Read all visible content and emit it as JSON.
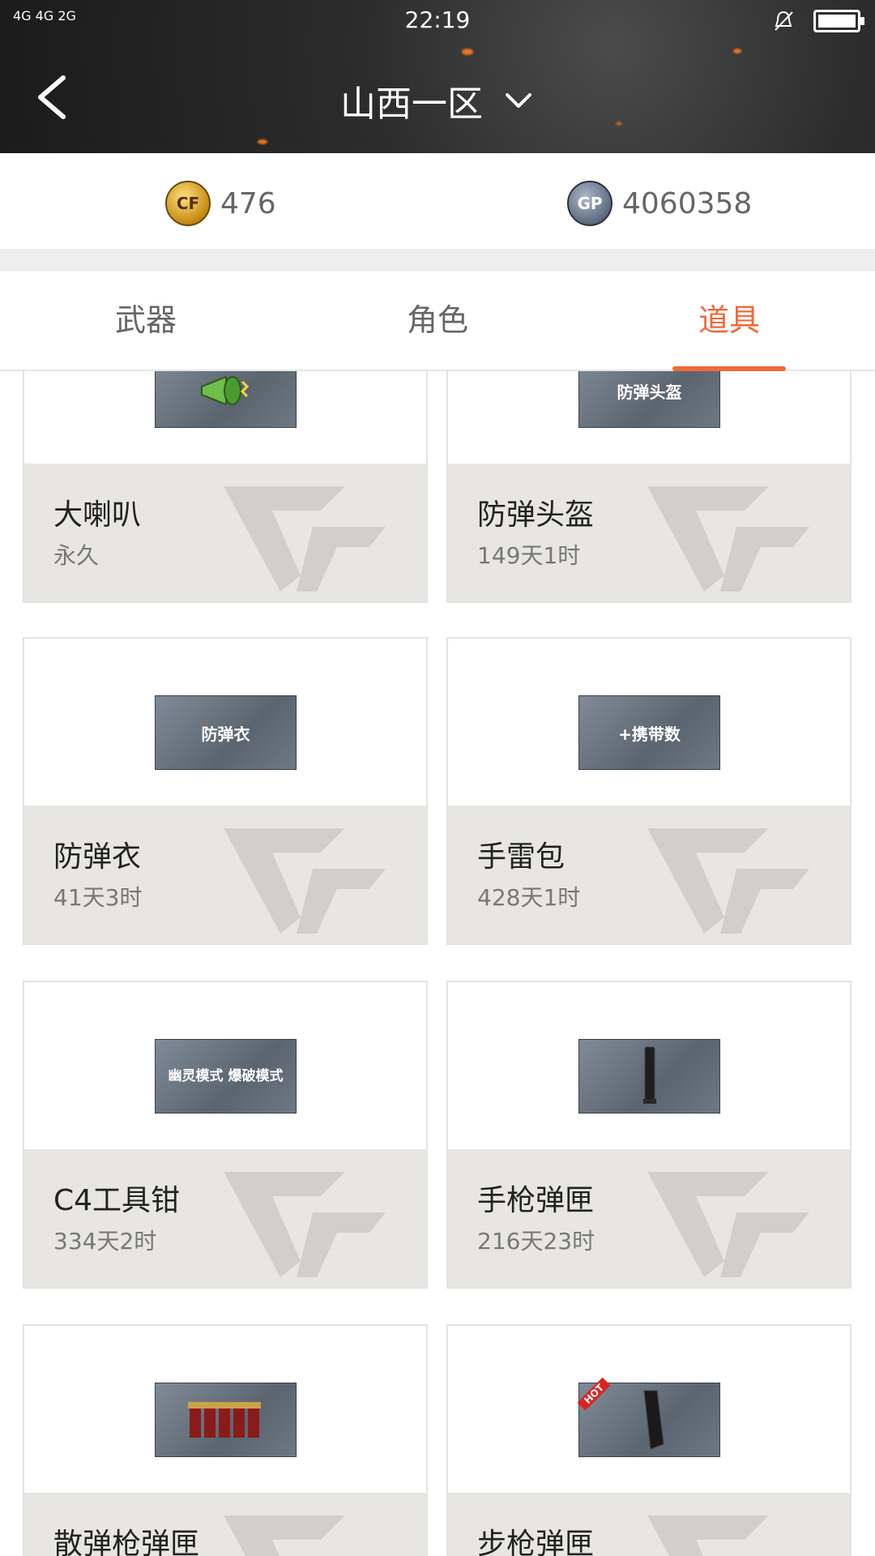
{
  "status_bar": {
    "network": "4G 4G 2G",
    "time": "22:19"
  },
  "header": {
    "title": "山西一区"
  },
  "currency": {
    "cf_points": "476",
    "gp_points": "4060358",
    "cf_icon": "cf-coin-icon",
    "gp_icon_text": "GP"
  },
  "tabs": [
    {
      "label": "武器",
      "active": false
    },
    {
      "label": "角色",
      "active": false
    },
    {
      "label": "道具",
      "active": true
    }
  ],
  "items": [
    {
      "name": "大喇叭",
      "duration": "永久",
      "image_text": ""
    },
    {
      "name": "防弹头盔",
      "duration": "149天1时",
      "image_text": "防弹头盔"
    },
    {
      "name": "防弹衣",
      "duration": "41天3时",
      "image_text": "防弹衣"
    },
    {
      "name": "手雷包",
      "duration": "428天1时",
      "image_text": "+携带数"
    },
    {
      "name": "C4工具钳",
      "duration": "334天2时",
      "image_text": "幽灵模式 爆破模式"
    },
    {
      "name": "手枪弹匣",
      "duration": "216天23时",
      "image_text": ""
    },
    {
      "name": "散弹枪弹匣",
      "duration": "",
      "image_text": ""
    },
    {
      "name": "步枪弹匣",
      "duration": "",
      "image_text": "HOT"
    }
  ],
  "colors": {
    "accent": "#f06a38",
    "header_bg": "#2c2c2c"
  }
}
